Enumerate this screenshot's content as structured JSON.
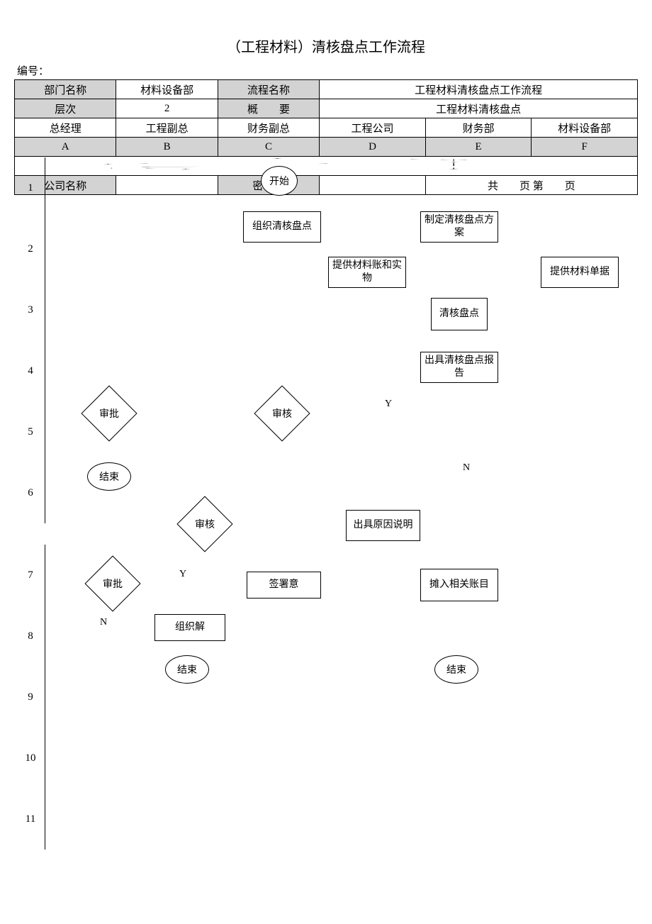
{
  "title": "（工程材料）清核盘点工作流程",
  "bianhao_label": "编号：",
  "header": {
    "row1": {
      "c1": "部门名称",
      "c2": "材料设备部",
      "c3": "流程名称",
      "c4": "工程材料清核盘点工作流程"
    },
    "row2": {
      "c1": "层次",
      "c2": "2",
      "c3": "概　　要",
      "c4": "工程材料清核盘点"
    },
    "row3": [
      "总经理",
      "工程副总",
      "财务副总",
      "工程公司",
      "财务部",
      "材料设备部"
    ],
    "row4": [
      "A",
      "B",
      "C",
      "D",
      "E",
      "F"
    ]
  },
  "rows": [
    "1",
    "2",
    "3",
    "4",
    "5",
    "6",
    "7",
    "8",
    "9",
    "10",
    "11"
  ],
  "nodes": {
    "start": "开始",
    "zzqh": "组织清核盘点",
    "zdfa": "制定清核盘点方案",
    "tgzh": "提供材料账和实物",
    "tgdj": "提供材料单据",
    "qh": "清核盘点",
    "bg": "出具清核盘点报告",
    "sh1": "审核",
    "sp1": "审批",
    "end1": "结束",
    "yysm": "出具原因说明",
    "sh2": "审核",
    "sp2": "审批",
    "qsy": "签署意",
    "tr": "摊入相关账目",
    "zzjj": "组织解",
    "end2": "结束",
    "end3": "结束",
    "y1": "Y",
    "n1": "N",
    "y2": "Y",
    "n2": "N"
  },
  "footer": {
    "c1": "公司名称",
    "c2": "",
    "c3": "密　级",
    "c4": "",
    "c5": "共　　页 第　　页"
  }
}
